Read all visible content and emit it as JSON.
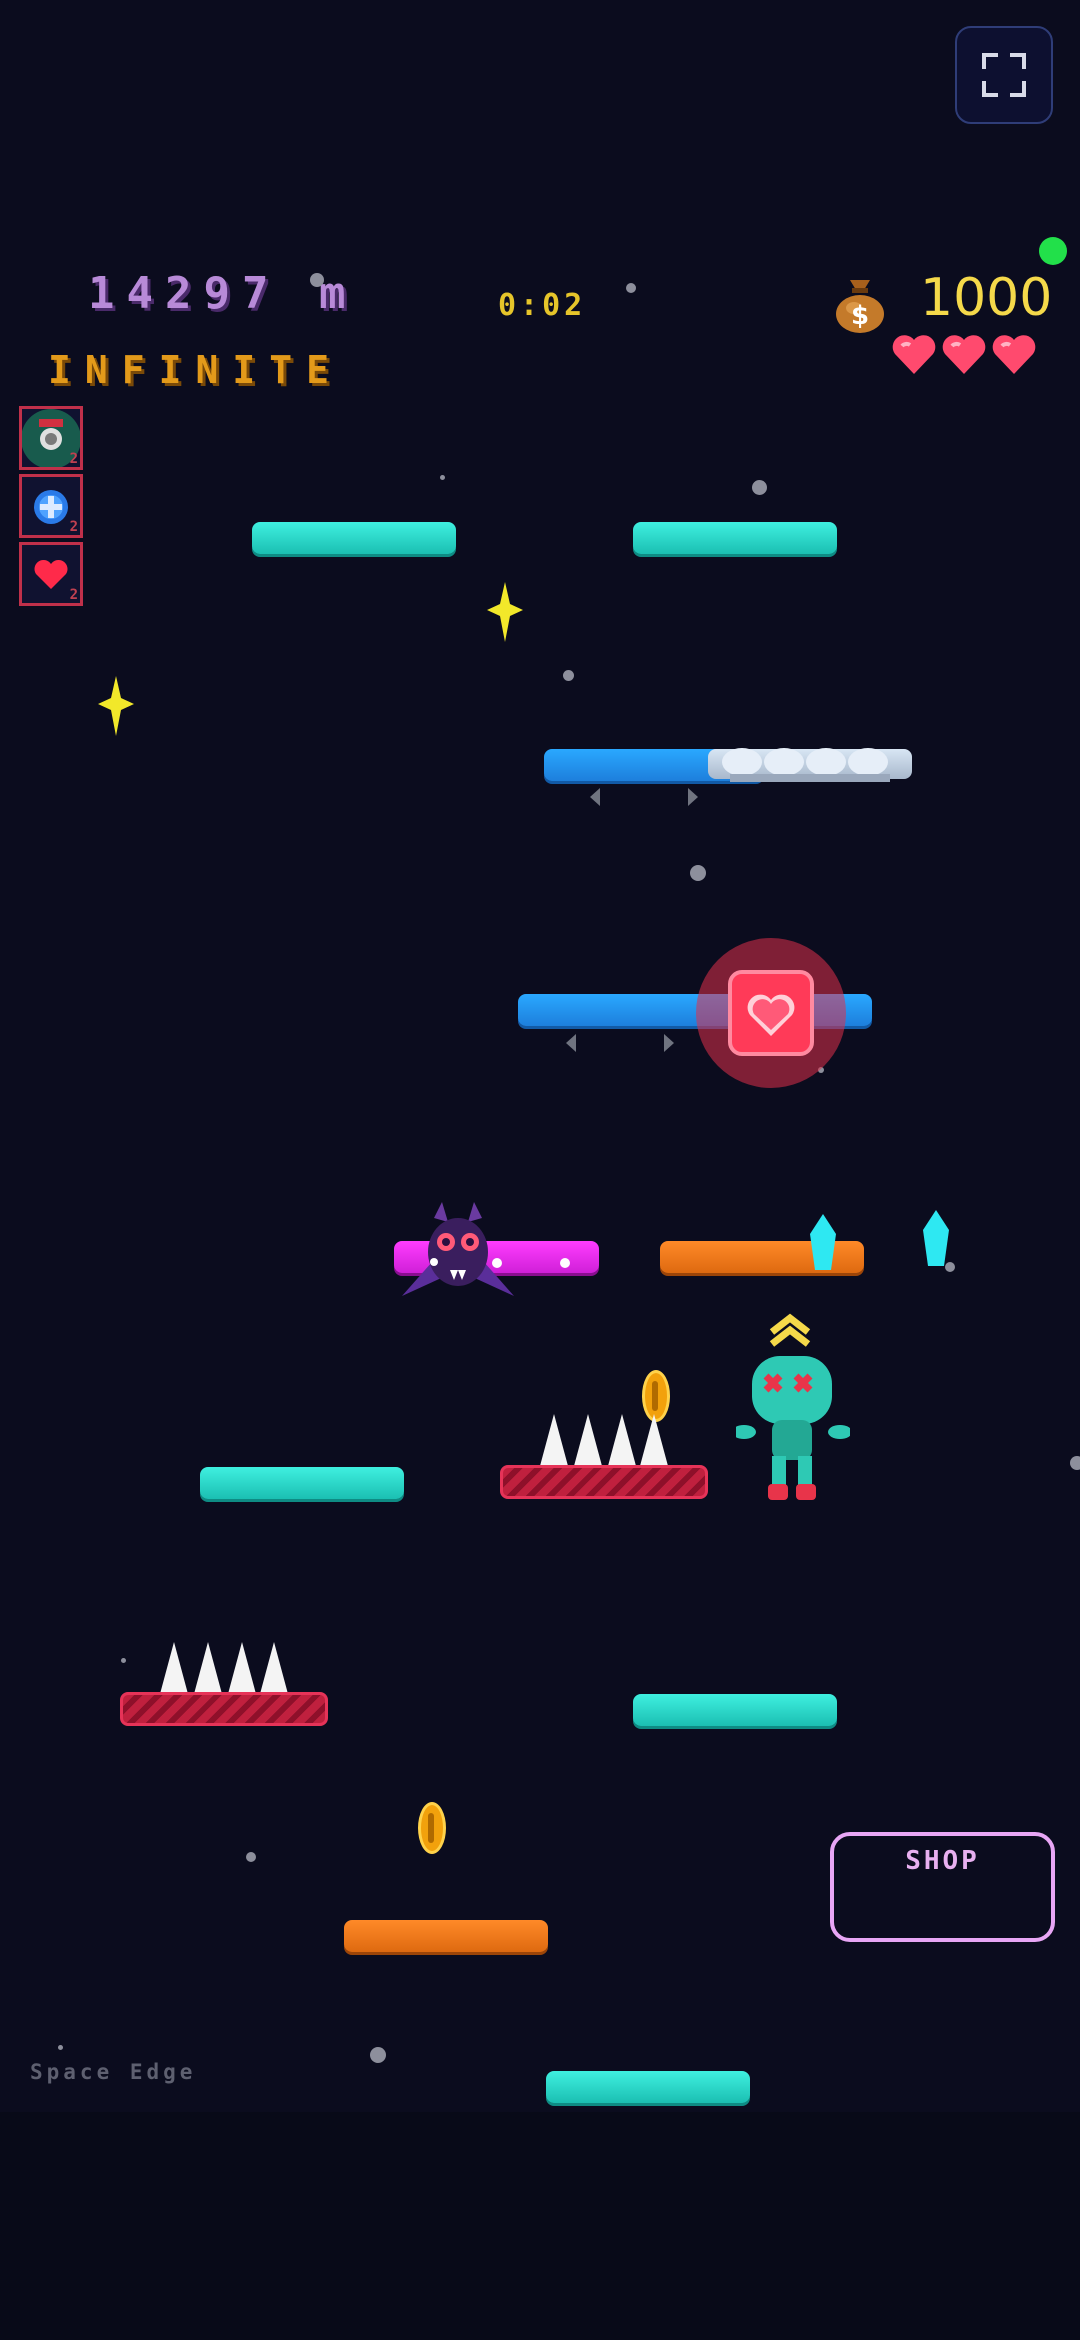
{
  "hud": {
    "distance": "14297 m",
    "timer": "0:02",
    "mode": "INFINITE",
    "coins": "1000",
    "lives": 3,
    "status_color": "#22e04a"
  },
  "powerups": [
    {
      "icon": "magnet-icon",
      "count": "2"
    },
    {
      "icon": "shield-icon",
      "count": "2"
    },
    {
      "icon": "heart-icon",
      "count": "2"
    }
  ],
  "shop": {
    "label": "SHOP"
  },
  "zone": {
    "label": "Space Edge"
  },
  "icons": {
    "fullscreen": "fullscreen-icon",
    "money": "money-bag-icon",
    "life": "heart-icon"
  },
  "colors": {
    "background": "#0b0c1e",
    "platform_cyan": "#2ee3d3",
    "platform_blue": "#2396f0",
    "platform_orange": "#f07a18",
    "platform_magenta": "#ee2ef0",
    "spike_platform": "#c0203e",
    "player": "#2ec9b4",
    "enemy": "#4a2a7a"
  }
}
